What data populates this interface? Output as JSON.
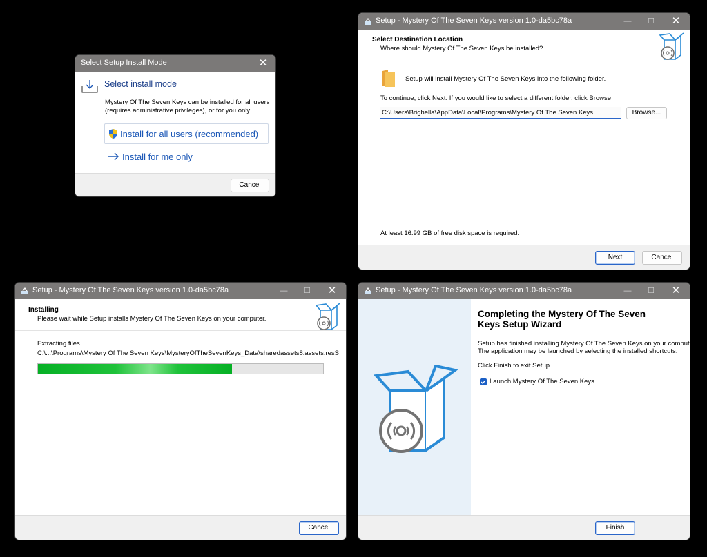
{
  "mode_dialog": {
    "title": "Select Setup Install Mode",
    "heading": "Select install mode",
    "description_line1": "Mystery Of The Seven Keys can be installed for all users",
    "description_line2": "(requires administrative privileges), or for you only.",
    "option_all_users": "Install for all users (recommended)",
    "option_me_only": "Install for me only",
    "cancel_label": "Cancel",
    "close_glyph": "✕"
  },
  "setup_title": "Setup - Mystery Of The Seven Keys version 1.0-da5bc78a",
  "window_controls": {
    "minimize": "—",
    "maximize": "☐",
    "close": "✕"
  },
  "destination": {
    "heading": "Select Destination Location",
    "subheading": "Where should Mystery Of The Seven Keys be installed?",
    "info": "Setup will install Mystery Of The Seven Keys into the following folder.",
    "instruction": "To continue, click Next. If you would like to select a different folder, click Browse.",
    "path_value": "C:\\Users\\Brighella\\AppData\\Local\\Programs\\Mystery Of The Seven Keys",
    "browse_label": "Browse...",
    "disk_space": "At least 16.99 GB of free disk space is required.",
    "next_label": "Next",
    "cancel_label": "Cancel"
  },
  "installing": {
    "heading": "Installing",
    "subheading": "Please wait while Setup installs Mystery Of The Seven Keys on your computer.",
    "status": "Extracting files...",
    "current_file": "C:\\...\\Programs\\Mystery Of The Seven Keys\\MysteryOfTheSevenKeys_Data\\sharedassets8.assets.resS",
    "progress_percent": 68,
    "cancel_label": "Cancel"
  },
  "finish": {
    "heading_line1": "Completing the Mystery Of The Seven",
    "heading_line2": "Keys Setup Wizard",
    "body_line1": "Setup has finished installing Mystery Of The Seven Keys on your computer.",
    "body_line2": "The application may be launched by selecting the installed shortcuts.",
    "body_line3": "Click Finish to exit Setup.",
    "launch_label": "Launch Mystery Of The Seven Keys",
    "launch_checked": true,
    "finish_label": "Finish"
  },
  "colors": {
    "accent": "#2b66c9",
    "progress_green": "#06b025",
    "wizard_side": "#e8f1f9",
    "icon_blue": "#2a8bd6"
  },
  "icons": {
    "install_mode": "tray-download-icon",
    "shield": "uac-shield-icon",
    "arrow": "arrow-right-icon",
    "folder": "folder-icon",
    "setup_box": "setup-box-disc-icon"
  }
}
